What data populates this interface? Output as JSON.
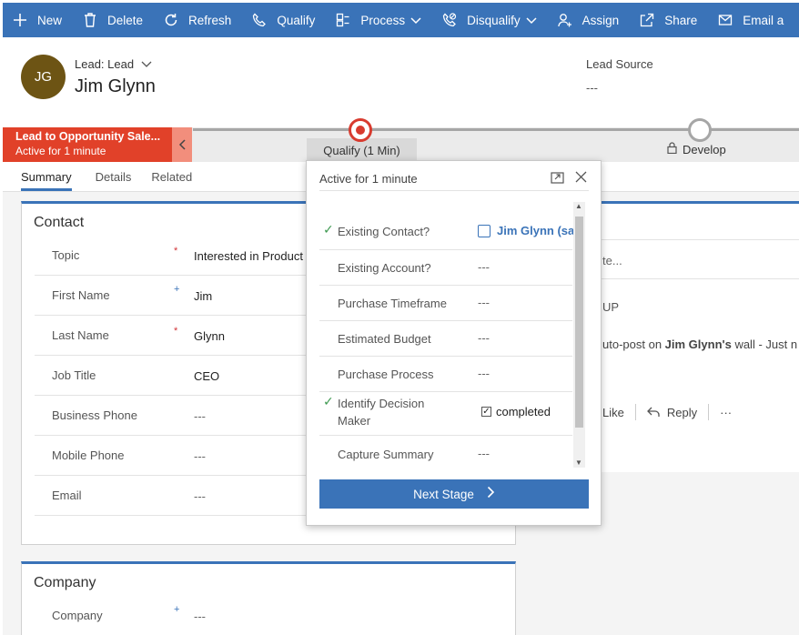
{
  "commandbar": {
    "items": [
      {
        "label": "New",
        "icon": "plus-icon"
      },
      {
        "label": "Delete",
        "icon": "trash-icon"
      },
      {
        "label": "Refresh",
        "icon": "refresh-icon"
      },
      {
        "label": "Qualify",
        "icon": "phone-icon"
      },
      {
        "label": "Process",
        "icon": "process-icon"
      },
      {
        "label": "Disqualify",
        "icon": "disqualify-icon"
      },
      {
        "label": "Assign",
        "icon": "assign-icon"
      },
      {
        "label": "Share",
        "icon": "share-icon"
      },
      {
        "label": "Email a",
        "icon": "email-icon"
      }
    ]
  },
  "header": {
    "initials": "JG",
    "entity": "Lead: Lead",
    "name": "Jim Glynn",
    "lead_source_label": "Lead Source",
    "lead_source_value": "---"
  },
  "process": {
    "active_name": "Lead to Opportunity Sale...",
    "active_duration": "Active for 1 minute",
    "qualify_label": "Qualify  (1 Min)",
    "develop_label": "Develop"
  },
  "tabs": [
    "Summary",
    "Details",
    "Related"
  ],
  "contact": {
    "title": "Contact",
    "fields": [
      {
        "label": "Topic",
        "marker": "*",
        "value": "Interested in Product A"
      },
      {
        "label": "First Name",
        "marker": "+",
        "value": "Jim"
      },
      {
        "label": "Last Name",
        "marker": "*",
        "value": "Glynn"
      },
      {
        "label": "Job Title",
        "marker": "",
        "value": "CEO"
      },
      {
        "label": "Business Phone",
        "marker": "",
        "value": "---"
      },
      {
        "label": "Mobile Phone",
        "marker": "",
        "value": "---"
      },
      {
        "label": "Email",
        "marker": "",
        "value": "---"
      }
    ]
  },
  "company": {
    "title": "Company",
    "fields": [
      {
        "label": "Company",
        "marker": "+",
        "value": "---"
      }
    ]
  },
  "timeline": {
    "note_placeholder": "te...",
    "group": "UP",
    "post_prefix": "uto-post on ",
    "post_name": "Jim Glynn's",
    "post_suffix": " wall -  Just n",
    "like": "Like",
    "reply": "Reply",
    "more": "···"
  },
  "flyout": {
    "title": "Active for 1 minute",
    "steps": [
      {
        "label": "Existing Contact?",
        "checked": true,
        "value": "Jim Glynn (sam",
        "kind": "link"
      },
      {
        "label": "Existing Account?",
        "checked": false,
        "value": "---",
        "kind": "text"
      },
      {
        "label": "Purchase Timeframe",
        "checked": false,
        "value": "---",
        "kind": "text"
      },
      {
        "label": "Estimated Budget",
        "checked": false,
        "value": "---",
        "kind": "text"
      },
      {
        "label": "Purchase Process",
        "checked": false,
        "value": "---",
        "kind": "text"
      },
      {
        "label": "Identify Decision Maker",
        "checked": true,
        "value": "completed",
        "kind": "checkbox"
      },
      {
        "label": "Capture Summary",
        "checked": false,
        "value": "---",
        "kind": "text"
      }
    ],
    "next_stage": "Next Stage"
  }
}
